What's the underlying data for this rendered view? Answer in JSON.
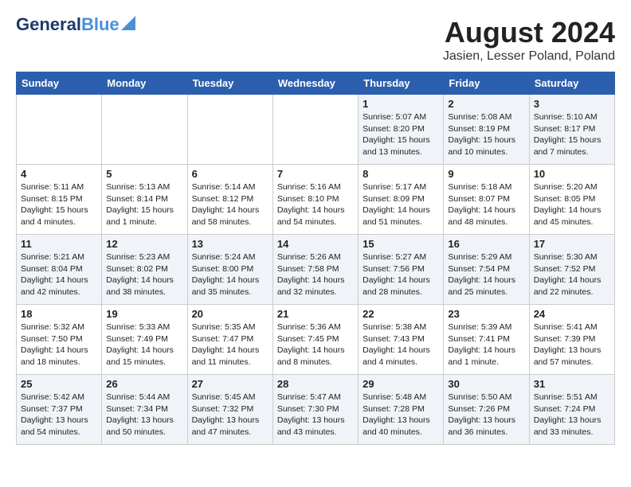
{
  "header": {
    "logo_line1": "General",
    "logo_line2": "Blue",
    "month_title": "August 2024",
    "location": "Jasien, Lesser Poland, Poland"
  },
  "days_of_week": [
    "Sunday",
    "Monday",
    "Tuesday",
    "Wednesday",
    "Thursday",
    "Friday",
    "Saturday"
  ],
  "weeks": [
    [
      {
        "day": "",
        "content": ""
      },
      {
        "day": "",
        "content": ""
      },
      {
        "day": "",
        "content": ""
      },
      {
        "day": "",
        "content": ""
      },
      {
        "day": "1",
        "content": "Sunrise: 5:07 AM\nSunset: 8:20 PM\nDaylight: 15 hours\nand 13 minutes."
      },
      {
        "day": "2",
        "content": "Sunrise: 5:08 AM\nSunset: 8:19 PM\nDaylight: 15 hours\nand 10 minutes."
      },
      {
        "day": "3",
        "content": "Sunrise: 5:10 AM\nSunset: 8:17 PM\nDaylight: 15 hours\nand 7 minutes."
      }
    ],
    [
      {
        "day": "4",
        "content": "Sunrise: 5:11 AM\nSunset: 8:15 PM\nDaylight: 15 hours\nand 4 minutes."
      },
      {
        "day": "5",
        "content": "Sunrise: 5:13 AM\nSunset: 8:14 PM\nDaylight: 15 hours\nand 1 minute."
      },
      {
        "day": "6",
        "content": "Sunrise: 5:14 AM\nSunset: 8:12 PM\nDaylight: 14 hours\nand 58 minutes."
      },
      {
        "day": "7",
        "content": "Sunrise: 5:16 AM\nSunset: 8:10 PM\nDaylight: 14 hours\nand 54 minutes."
      },
      {
        "day": "8",
        "content": "Sunrise: 5:17 AM\nSunset: 8:09 PM\nDaylight: 14 hours\nand 51 minutes."
      },
      {
        "day": "9",
        "content": "Sunrise: 5:18 AM\nSunset: 8:07 PM\nDaylight: 14 hours\nand 48 minutes."
      },
      {
        "day": "10",
        "content": "Sunrise: 5:20 AM\nSunset: 8:05 PM\nDaylight: 14 hours\nand 45 minutes."
      }
    ],
    [
      {
        "day": "11",
        "content": "Sunrise: 5:21 AM\nSunset: 8:04 PM\nDaylight: 14 hours\nand 42 minutes."
      },
      {
        "day": "12",
        "content": "Sunrise: 5:23 AM\nSunset: 8:02 PM\nDaylight: 14 hours\nand 38 minutes."
      },
      {
        "day": "13",
        "content": "Sunrise: 5:24 AM\nSunset: 8:00 PM\nDaylight: 14 hours\nand 35 minutes."
      },
      {
        "day": "14",
        "content": "Sunrise: 5:26 AM\nSunset: 7:58 PM\nDaylight: 14 hours\nand 32 minutes."
      },
      {
        "day": "15",
        "content": "Sunrise: 5:27 AM\nSunset: 7:56 PM\nDaylight: 14 hours\nand 28 minutes."
      },
      {
        "day": "16",
        "content": "Sunrise: 5:29 AM\nSunset: 7:54 PM\nDaylight: 14 hours\nand 25 minutes."
      },
      {
        "day": "17",
        "content": "Sunrise: 5:30 AM\nSunset: 7:52 PM\nDaylight: 14 hours\nand 22 minutes."
      }
    ],
    [
      {
        "day": "18",
        "content": "Sunrise: 5:32 AM\nSunset: 7:50 PM\nDaylight: 14 hours\nand 18 minutes."
      },
      {
        "day": "19",
        "content": "Sunrise: 5:33 AM\nSunset: 7:49 PM\nDaylight: 14 hours\nand 15 minutes."
      },
      {
        "day": "20",
        "content": "Sunrise: 5:35 AM\nSunset: 7:47 PM\nDaylight: 14 hours\nand 11 minutes."
      },
      {
        "day": "21",
        "content": "Sunrise: 5:36 AM\nSunset: 7:45 PM\nDaylight: 14 hours\nand 8 minutes."
      },
      {
        "day": "22",
        "content": "Sunrise: 5:38 AM\nSunset: 7:43 PM\nDaylight: 14 hours\nand 4 minutes."
      },
      {
        "day": "23",
        "content": "Sunrise: 5:39 AM\nSunset: 7:41 PM\nDaylight: 14 hours\nand 1 minute."
      },
      {
        "day": "24",
        "content": "Sunrise: 5:41 AM\nSunset: 7:39 PM\nDaylight: 13 hours\nand 57 minutes."
      }
    ],
    [
      {
        "day": "25",
        "content": "Sunrise: 5:42 AM\nSunset: 7:37 PM\nDaylight: 13 hours\nand 54 minutes."
      },
      {
        "day": "26",
        "content": "Sunrise: 5:44 AM\nSunset: 7:34 PM\nDaylight: 13 hours\nand 50 minutes."
      },
      {
        "day": "27",
        "content": "Sunrise: 5:45 AM\nSunset: 7:32 PM\nDaylight: 13 hours\nand 47 minutes."
      },
      {
        "day": "28",
        "content": "Sunrise: 5:47 AM\nSunset: 7:30 PM\nDaylight: 13 hours\nand 43 minutes."
      },
      {
        "day": "29",
        "content": "Sunrise: 5:48 AM\nSunset: 7:28 PM\nDaylight: 13 hours\nand 40 minutes."
      },
      {
        "day": "30",
        "content": "Sunrise: 5:50 AM\nSunset: 7:26 PM\nDaylight: 13 hours\nand 36 minutes."
      },
      {
        "day": "31",
        "content": "Sunrise: 5:51 AM\nSunset: 7:24 PM\nDaylight: 13 hours\nand 33 minutes."
      }
    ]
  ]
}
